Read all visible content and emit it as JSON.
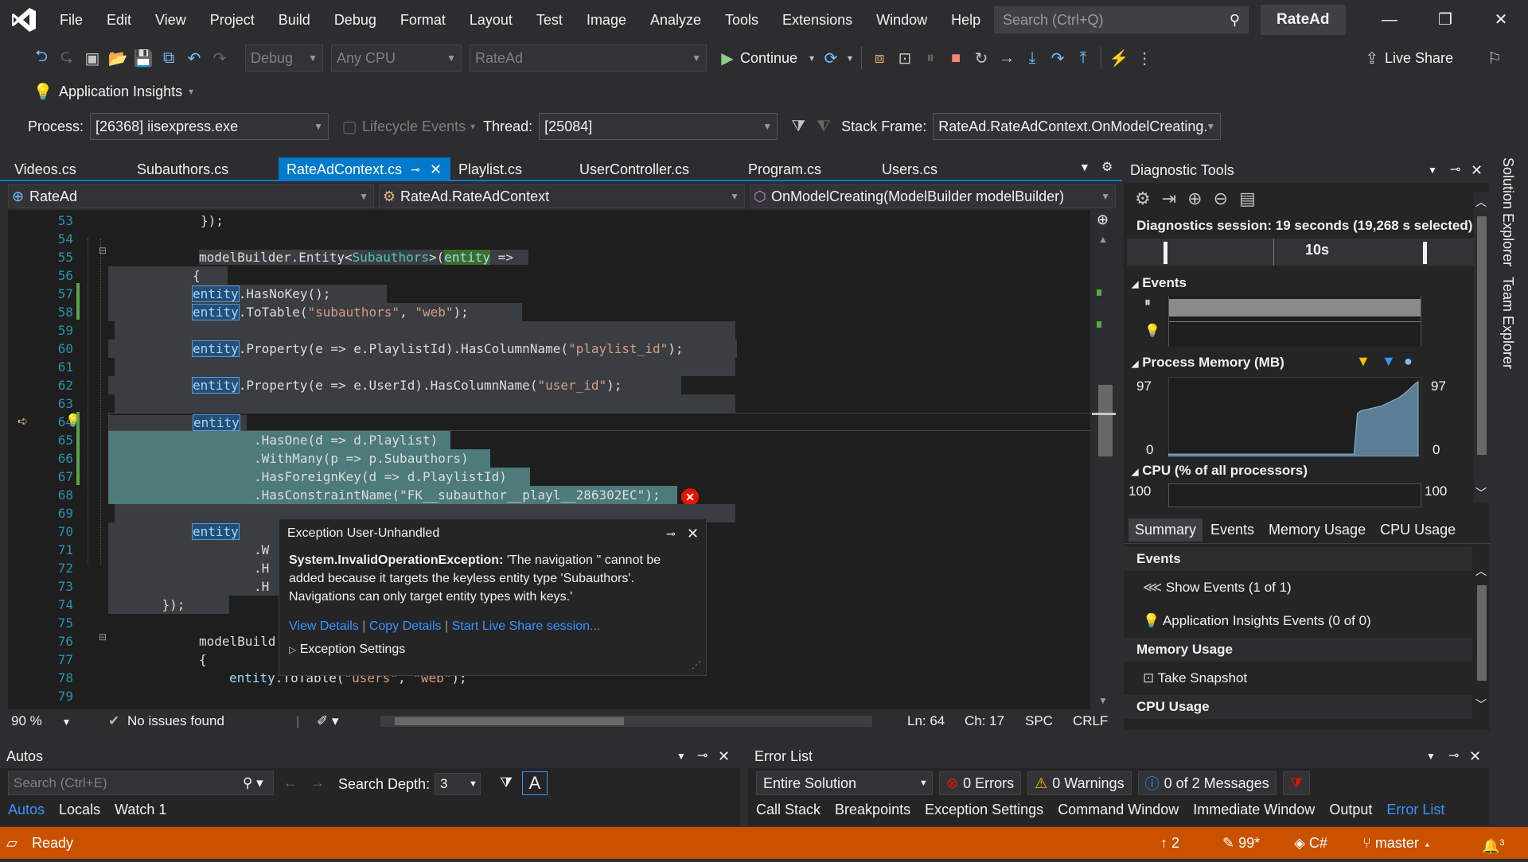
{
  "menubar": {
    "items": [
      "File",
      "Edit",
      "View",
      "Project",
      "Build",
      "Debug",
      "Format",
      "Layout",
      "Test",
      "Image",
      "Analyze",
      "Tools",
      "Extensions",
      "Window",
      "Help"
    ],
    "search_placeholder": "Search (Ctrl+Q)",
    "solution_name": "RateAd"
  },
  "toolbar": {
    "config": "Debug",
    "platform": "Any CPU",
    "startup": "RateAd",
    "continue_label": "Continue",
    "live_share": "Live Share",
    "app_insights": "Application Insights"
  },
  "debugbar": {
    "process_label": "Process:",
    "process_value": "[26368] iisexpress.exe",
    "lifecycle": "Lifecycle Events",
    "thread_label": "Thread:",
    "thread_value": "[25084]",
    "stack_label": "Stack Frame:",
    "stack_value": "RateAd.RateAdContext.OnModelCreating."
  },
  "tabs": [
    "Videos.cs",
    "Subauthors.cs",
    "RateAdContext.cs",
    "Playlist.cs",
    "UserController.cs",
    "Program.cs",
    "Users.cs"
  ],
  "active_tab": "RateAdContext.cs",
  "navbar": {
    "project": "RateAd",
    "type": "RateAd.RateAdContext",
    "member": "OnModelCreating(ModelBuilder modelBuilder)"
  },
  "code": {
    "line_numbers": [
      "53",
      "54",
      "55",
      "56",
      "57",
      "58",
      "59",
      "60",
      "61",
      "62",
      "63",
      "64",
      "65",
      "66",
      "67",
      "68",
      "69",
      "70",
      "71",
      "72",
      "73",
      "74",
      "75",
      "76",
      "77",
      "78",
      "79"
    ],
    "l53": "});",
    "l55_a": "modelBuilder.Entity<",
    "l55_b": "Subauthors",
    "l55_c": ">(",
    "l55_d": "entity",
    "l55_e": " =>",
    "l56": "{",
    "entity": "entity",
    "l57": ".HasNoKey();",
    "l58_a": ".ToTable(",
    "l58_b": "\"subauthors\"",
    "l58_c": ", ",
    "l58_d": "\"web\"",
    "l58_e": ");",
    "l60_a": ".Property(e => e.PlaylistId).HasColumnName(",
    "l60_b": "\"playlist_id\"",
    "l60_c": ");",
    "l62_a": ".Property(e => e.UserId).HasColumnName(",
    "l62_b": "\"user_id\"",
    "l62_c": ");",
    "l65": ".HasOne(d => d.Playlist)",
    "l66": ".WithMany(p => p.Subauthors)",
    "l67": ".HasForeignKey(d => d.PlaylistId)",
    "l68_a": ".HasConstraintName(",
    "l68_b": "\"FK__subauthor__playl__286302EC\"",
    "l68_c": ");",
    "l71": ".W",
    "l72": ".H",
    "l73": ".H",
    "l74": "});",
    "l76": "modelBuild",
    "l77": "{",
    "l78_a": ".ToTable(",
    "l78_b": "\"users\"",
    "l78_c": ", ",
    "l78_d": "\"web\"",
    "l78_e": ");"
  },
  "exception": {
    "title": "Exception User-Unhandled",
    "type": "System.InvalidOperationException:",
    "message": "'The navigation '' cannot be added because it targets the keyless entity type 'Subauthors'. Navigations can only target entity types with keys.'",
    "view_details": "View Details",
    "copy_details": "Copy Details",
    "live_share": "Start Live Share session...",
    "settings": "Exception Settings"
  },
  "editor_status": {
    "zoom": "90 %",
    "issues": "No issues found",
    "ln": "Ln: 64",
    "ch": "Ch: 17",
    "spc": "SPC",
    "crlf": "CRLF"
  },
  "diagnostics": {
    "title": "Diagnostic Tools",
    "session": "Diagnostics session: 19 seconds (19,268 s selected)",
    "timeline_label": "10s",
    "events_label": "Events",
    "memory_label": "Process Memory (MB)",
    "mem_max": "97",
    "mem_min": "0",
    "cpu_label": "CPU (% of all processors)",
    "cpu_max": "100",
    "tabs": [
      "Summary",
      "Events",
      "Memory Usage",
      "CPU Usage"
    ],
    "active_tab": "Summary",
    "section_events": "Events",
    "show_events": "Show Events (1 of 1)",
    "ai_events": "Application Insights Events (0 of 0)",
    "section_memory": "Memory Usage",
    "take_snapshot": "Take Snapshot",
    "section_cpu": "CPU Usage"
  },
  "right_rail": [
    "Solution Explorer",
    "Team Explorer"
  ],
  "autos": {
    "title": "Autos",
    "search_placeholder": "Search (Ctrl+E)",
    "depth_label": "Search Depth:",
    "depth_value": "3",
    "tabs": [
      "Autos",
      "Locals",
      "Watch 1"
    ],
    "active_tab": "Autos"
  },
  "errorlist": {
    "title": "Error List",
    "scope": "Entire Solution",
    "errors": "0 Errors",
    "warnings": "0 Warnings",
    "messages": "0 of 2 Messages",
    "tabs": [
      "Call Stack",
      "Breakpoints",
      "Exception Settings",
      "Command Window",
      "Immediate Window",
      "Output",
      "Error List"
    ],
    "active_tab": "Error List"
  },
  "statusbar": {
    "ready": "Ready",
    "up": "2",
    "pencil": "99*",
    "lang": "C#",
    "branch": "master",
    "notif": "3"
  },
  "colors": {
    "accent": "#007acc",
    "status_orange": "#ca5100",
    "error_red": "#e51400"
  },
  "memory_chart": {
    "type": "area",
    "ylim": [
      0,
      97
    ],
    "values": [
      3,
      3,
      3,
      3,
      3,
      3,
      3,
      3,
      3,
      3,
      3,
      3,
      3,
      3,
      3,
      3,
      3,
      3,
      3,
      3,
      3,
      3,
      3,
      3,
      3,
      3,
      3,
      3,
      3,
      3,
      3,
      3,
      3,
      3,
      3,
      3,
      3,
      3,
      3,
      3,
      3,
      3,
      3,
      3,
      3,
      3,
      3,
      3,
      3,
      3,
      3,
      3,
      3,
      3,
      3,
      3,
      55,
      58,
      59,
      60,
      61,
      62,
      63,
      64,
      66,
      68,
      70,
      72,
      74,
      77,
      80,
      84,
      88,
      92,
      95
    ]
  }
}
